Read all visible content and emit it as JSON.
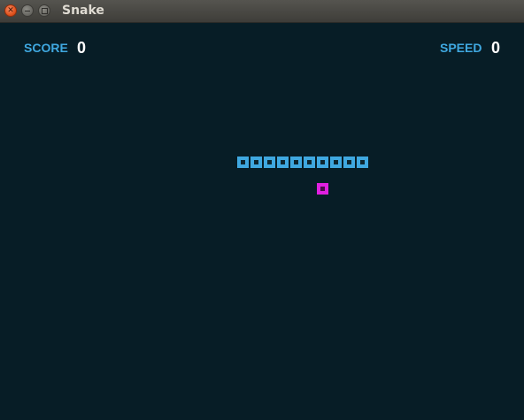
{
  "window": {
    "title": "Snake",
    "buttons": [
      "close-icon",
      "minimize-icon",
      "maximize-icon"
    ]
  },
  "hud": {
    "score_label": "SCORE",
    "score_value": "0",
    "speed_label": "SPEED",
    "speed_value": "0"
  },
  "game": {
    "snake": {
      "color": "#3fa8e0",
      "cells": [
        [
          0,
          0
        ],
        [
          1,
          0
        ],
        [
          2,
          0
        ],
        [
          3,
          0
        ],
        [
          4,
          0
        ],
        [
          5,
          0
        ],
        [
          6,
          0
        ],
        [
          7,
          0
        ],
        [
          8,
          0
        ],
        [
          9,
          0
        ]
      ]
    },
    "food": {
      "color": "#e020e0",
      "cell": [
        6,
        2
      ]
    },
    "background_color": "#071d26"
  }
}
